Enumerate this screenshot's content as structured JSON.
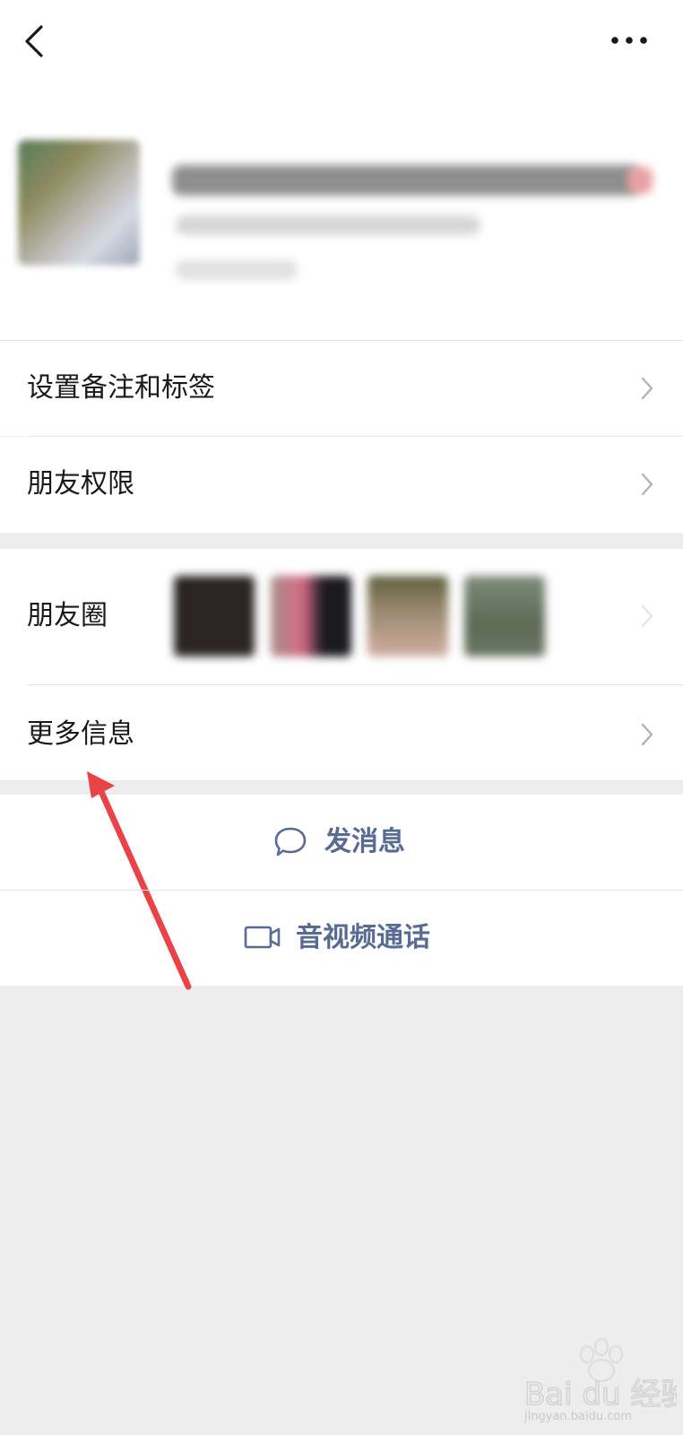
{
  "nav": {
    "back_icon": "chevron-left-icon",
    "more_icon": "more-dots-icon"
  },
  "menu": {
    "remark": "设置备注和标签",
    "permissions": "朋友权限",
    "moments": "朋友圈",
    "more_info": "更多信息"
  },
  "actions": {
    "message": "发消息",
    "call": "音视频通话"
  },
  "colors": {
    "background": "#ededed",
    "action": "#576b95",
    "annotation_arrow": "#e94348"
  },
  "watermark": {
    "brand": "Bai du 经验",
    "url": "jingyan.baidu.com"
  }
}
